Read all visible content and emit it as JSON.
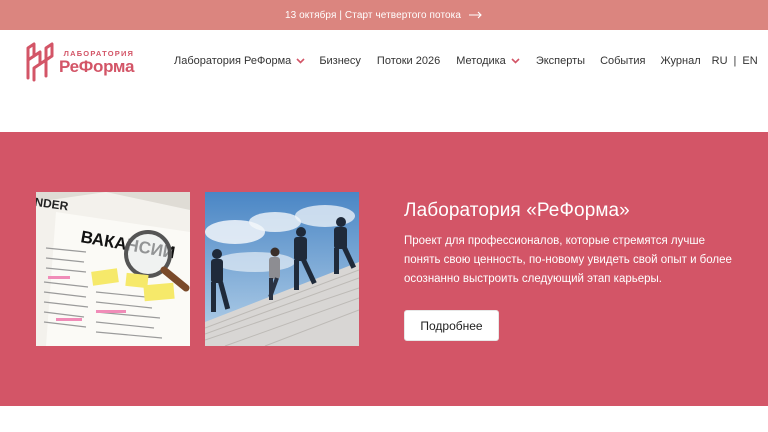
{
  "announcement": {
    "text": "13 октября | Старт четвертого потока",
    "arrow_icon": "arrow-right-icon"
  },
  "logo": {
    "small": "ЛАБОРАТОРИЯ",
    "big": "РеФорма",
    "brand_color": "#d35567"
  },
  "nav": {
    "items": [
      {
        "label": "Лаборатория РеФорма",
        "has_dropdown": true
      },
      {
        "label": "Бизнесу",
        "has_dropdown": false
      },
      {
        "label": "Потоки 2026",
        "has_dropdown": false
      },
      {
        "label": "Методика",
        "has_dropdown": true
      },
      {
        "label": "Эксперты",
        "has_dropdown": false
      },
      {
        "label": "События",
        "has_dropdown": false
      },
      {
        "label": "Журнал",
        "has_dropdown": false
      }
    ],
    "lang": {
      "ru": "RU",
      "en": "EN"
    }
  },
  "hero": {
    "title": "Лаборатория «РеФорма»",
    "description": "Проект для профессионалов, которые стремятся лучше понять свою ценность, по-новому увидеть свой опыт и более осознанно выстроить следующий этап карьеры.",
    "button_label": "Подробнее",
    "background_color": "#d35567",
    "image1_alt": "ВАКАНСИИ",
    "image2_alt": "people-running-up-stairs"
  },
  "colors": {
    "topbar": "#db857f",
    "accent": "#d35567",
    "chevron": "#d35567"
  }
}
